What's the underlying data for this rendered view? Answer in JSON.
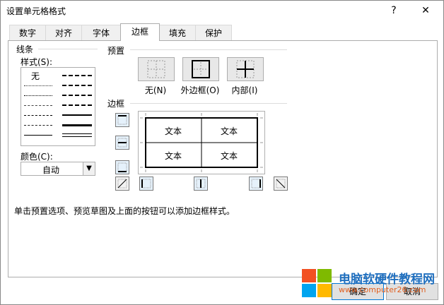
{
  "window": {
    "title": "设置单元格格式",
    "help": "?",
    "close": "✕"
  },
  "tabs": [
    {
      "label": "数字"
    },
    {
      "label": "对齐"
    },
    {
      "label": "字体"
    },
    {
      "label": "边框"
    },
    {
      "label": "填充"
    },
    {
      "label": "保护"
    }
  ],
  "active_tab": "边框",
  "line": {
    "group": "线条",
    "style_label": "样式(S):",
    "none_label": "无",
    "color_label": "颜色(C):",
    "color_value": "自动"
  },
  "presets": {
    "group": "预置",
    "items": [
      {
        "label": "无(N)"
      },
      {
        "label": "外边框(O)"
      },
      {
        "label": "内部(I)"
      }
    ]
  },
  "border": {
    "group": "边框",
    "preview_cells": [
      "文本",
      "文本",
      "文本",
      "文本"
    ]
  },
  "hint": "单击预置选项、预览草图及上面的按钮可以添加边框样式。",
  "buttons": {
    "ok": "确定",
    "cancel": "取消"
  },
  "watermark": {
    "title": "电脑软硬件教程网",
    "url": "www.computer26.com"
  },
  "colors": {
    "accent": "#0078d7",
    "selected_button": "#e5f1fb"
  }
}
